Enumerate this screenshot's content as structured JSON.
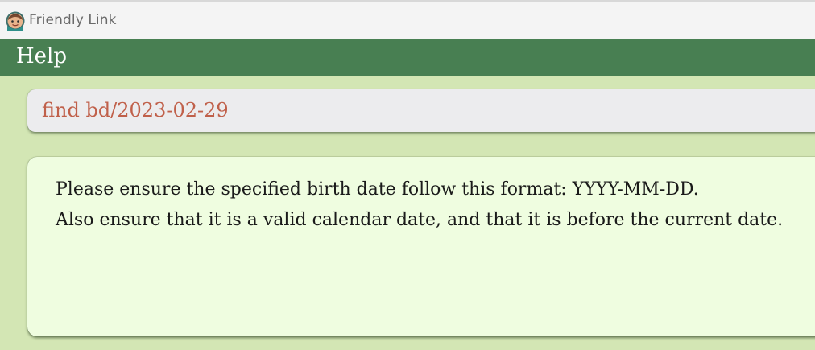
{
  "window": {
    "title": "Friendly Link",
    "icon": "app-avatar-icon"
  },
  "menu": {
    "help_label": "Help"
  },
  "command": {
    "value": "find bd/2023-02-29"
  },
  "result": {
    "lines": [
      "Please ensure the specified birth date follow this format: YYYY-MM-DD.",
      "Also ensure that it is a valid calendar date, and that it is before the current date."
    ]
  },
  "colors": {
    "menubar": "#487f52",
    "background": "#d3e6b4",
    "command_text": "#c0604a",
    "result_background": "#effde0"
  }
}
